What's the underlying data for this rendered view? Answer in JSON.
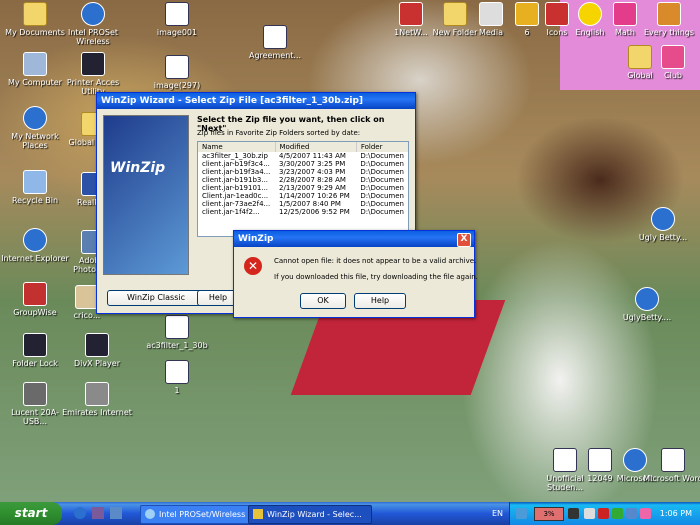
{
  "desktop_icons": [
    {
      "name": "my-documents-icon",
      "label": "My Documents"
    },
    {
      "name": "intel-proset-wireless-icon",
      "label": "Intel PROSet Wireless"
    },
    {
      "name": "image001-icon",
      "label": "image001"
    },
    {
      "name": "agreement-doc-icon",
      "label": "Agreement..."
    },
    {
      "name": "net-icon",
      "label": "1NetW..."
    },
    {
      "name": "new-folder-icon",
      "label": "New Folder"
    },
    {
      "name": "media-icon",
      "label": "Media"
    },
    {
      "name": "pencil-icon",
      "label": "6"
    },
    {
      "name": "icons-icon",
      "label": "Icons"
    },
    {
      "name": "english-icon",
      "label": "English"
    },
    {
      "name": "math-icon",
      "label": "Math"
    },
    {
      "name": "every-things-icon",
      "label": "Every things"
    },
    {
      "name": "my-computer-icon",
      "label": "My Computer"
    },
    {
      "name": "printer-access-icon",
      "label": "Printer Acces Utility"
    },
    {
      "name": "image297-icon",
      "label": "image(297)"
    },
    {
      "name": "global-icon",
      "label": "Global"
    },
    {
      "name": "club-icon",
      "label": "Club"
    },
    {
      "name": "my-network-places-icon",
      "label": "My Network Places"
    },
    {
      "name": "global-tree-icon",
      "label": "Global Trees"
    },
    {
      "name": "recycle-bin-icon",
      "label": "Recycle Bin"
    },
    {
      "name": "realplayer-icon",
      "label": "RealPl..."
    },
    {
      "name": "internet-explorer-icon",
      "label": "Internet Explorer"
    },
    {
      "name": "adobe-photoshop-icon",
      "label": "Adob... Photosh..."
    },
    {
      "name": "groupwise-icon",
      "label": "GroupWise"
    },
    {
      "name": "cricket-icon",
      "label": "crico..."
    },
    {
      "name": "folder-lock-icon",
      "label": "Folder Lock"
    },
    {
      "name": "divx-player-icon",
      "label": "DivX Player"
    },
    {
      "name": "ac3filter-icon",
      "label": "ac3filter_1_30b"
    },
    {
      "name": "lucent-icon",
      "label": "Lucent 20A-USB..."
    },
    {
      "name": "emirates-internet-icon",
      "label": "Emirates Internet"
    },
    {
      "name": "file-1-icon",
      "label": "1"
    },
    {
      "name": "ugly-betty-1-icon",
      "label": "Ugly Betty..."
    },
    {
      "name": "ugly-betty-2-icon",
      "label": "UglyBetty...."
    },
    {
      "name": "unofficial-studen-icon",
      "label": "Unofficial Studen..."
    },
    {
      "name": "doc-12049-icon",
      "label": "12049"
    },
    {
      "name": "microsoft-icon",
      "label": "Microsoft"
    },
    {
      "name": "microsoft-word-icon",
      "label": "Microsoft Word"
    }
  ],
  "winzip_wizard": {
    "title": "WinZip Wizard - Select Zip File [ac3filter_1_30b.zip]",
    "heading": "Select the Zip file you want, then click on \"Next\"",
    "subheading": "Zip files in Favorite Zip Folders sorted by date:",
    "columns": [
      "Name",
      "Modified",
      "Folder"
    ],
    "rows": [
      [
        "ac3filter_1_30b.zip",
        "4/5/2007  11:43 AM",
        "D:\\Documen"
      ],
      [
        "client.jar-b19f3c4...",
        "3/30/2007  3:25 PM",
        "D:\\Documen"
      ],
      [
        "client.jar-b19f3a4...",
        "3/23/2007  4:03 PM",
        "D:\\Documen"
      ],
      [
        "client.jar-b191b3...",
        "2/28/2007  8:28 AM",
        "D:\\Documen"
      ],
      [
        "client.jar-b19101...",
        "2/13/2007  9:29 AM",
        "D:\\Documen"
      ],
      [
        "Client.jar-1ead0c...",
        "1/14/2007  10:26 PM",
        "D:\\Documen"
      ],
      [
        "client.jar-73ae2f4...",
        "1/5/2007  8:40 PM",
        "D:\\Documen"
      ],
      [
        "client.jar-1f4f2...",
        "12/25/2006  9:52 PM",
        "D:\\Documen"
      ]
    ],
    "logo_text": "WinZip",
    "classic_button": "WinZip Classic",
    "help_button": "Help"
  },
  "error_dialog": {
    "title": "WinZip",
    "close": "X",
    "message1": "Cannot open file: it does not appear to be a valid archive.",
    "message2": "If you downloaded this file, try downloading the file again.",
    "ok_button": "OK",
    "help_button": "Help",
    "error_icon": "error-icon"
  },
  "taskbar": {
    "start": "start",
    "tasks": [
      {
        "label": "Intel PROSet/Wireless"
      },
      {
        "label": "WinZip Wizard - Selec..."
      }
    ],
    "lang": "EN",
    "battery": "3%",
    "clock": "1:06 PM"
  }
}
